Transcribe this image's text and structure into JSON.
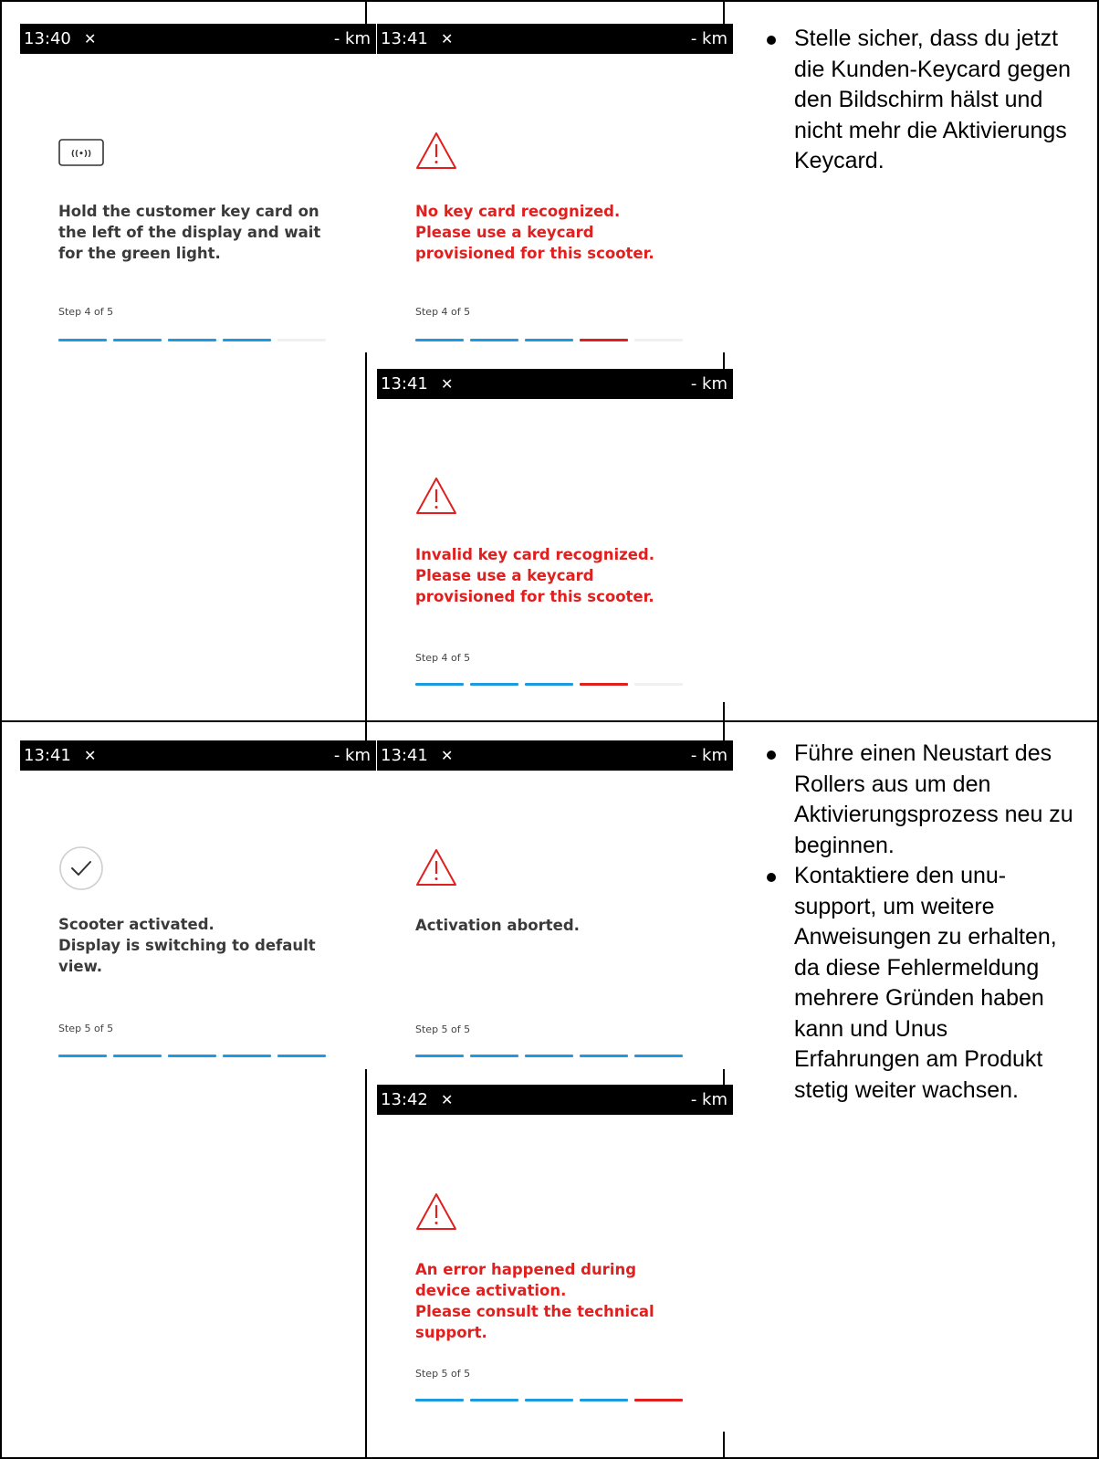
{
  "screens": [
    {
      "time": "13:40",
      "km": "- km",
      "message": "Hold the customer key card on\nthe left of the display and wait\nfor the green light.",
      "step": "Step 4 of 5",
      "icon": "nfc-card-icon",
      "bars": [
        "blue",
        "blue",
        "blue",
        "blue",
        "empty"
      ]
    },
    {
      "time": "13:41",
      "km": "- km",
      "message": "No key card recognized.\nPlease use a keycard\nprovisioned for this scooter.",
      "step": "Step 4 of 5",
      "icon": "warning-icon",
      "bars": [
        "blue",
        "blue",
        "blue",
        "red",
        "empty"
      ]
    },
    {
      "time": "13:41",
      "km": "- km",
      "message": "Invalid key card recognized.\nPlease use a keycard\nprovisioned for this scooter.",
      "step": "Step 4 of 5",
      "icon": "warning-icon",
      "bars": [
        "blue",
        "blue",
        "blue",
        "red",
        "empty"
      ]
    },
    {
      "time": "13:41",
      "km": "- km",
      "message": "Scooter activated.\nDisplay is switching to default\nview.",
      "step": "Step 5 of 5",
      "icon": "check-circle-icon",
      "bars": [
        "blue",
        "blue",
        "blue",
        "blue",
        "blue"
      ]
    },
    {
      "time": "13:41",
      "km": "- km",
      "message": "Activation aborted.",
      "step": "Step 5 of 5",
      "icon": "warning-icon",
      "bars": [
        "blue",
        "blue",
        "blue",
        "blue",
        "blue"
      ]
    },
    {
      "time": "13:42",
      "km": "- km",
      "message": "An error happened during\ndevice activation.\nPlease consult the technical\nsupport.",
      "step": "Step 5 of 5",
      "icon": "warning-icon",
      "bars": [
        "blue",
        "blue",
        "blue",
        "blue",
        "red"
      ]
    }
  ],
  "notes_top": [
    "Stelle sicher, dass du jetzt die Kunden-Keycard gegen den Bildschirm hälst und nicht mehr die Aktivierungs Keycard."
  ],
  "notes_bottom": [
    "Führe einen Neustart des Rollers aus um den Aktivierungsprozess neu zu beginnen.",
    "Kontaktiere den unu-support, um weitere Anweisungen zu erhalten, da diese Fehlermeldung mehrere Gründen haben kann und Unus Erfahrungen am Produkt stetig weiter wachsen."
  ],
  "colors": {
    "accent_blue": "#1e9be0",
    "error_red": "#e0201f",
    "text_dark": "#3a3a3a"
  }
}
